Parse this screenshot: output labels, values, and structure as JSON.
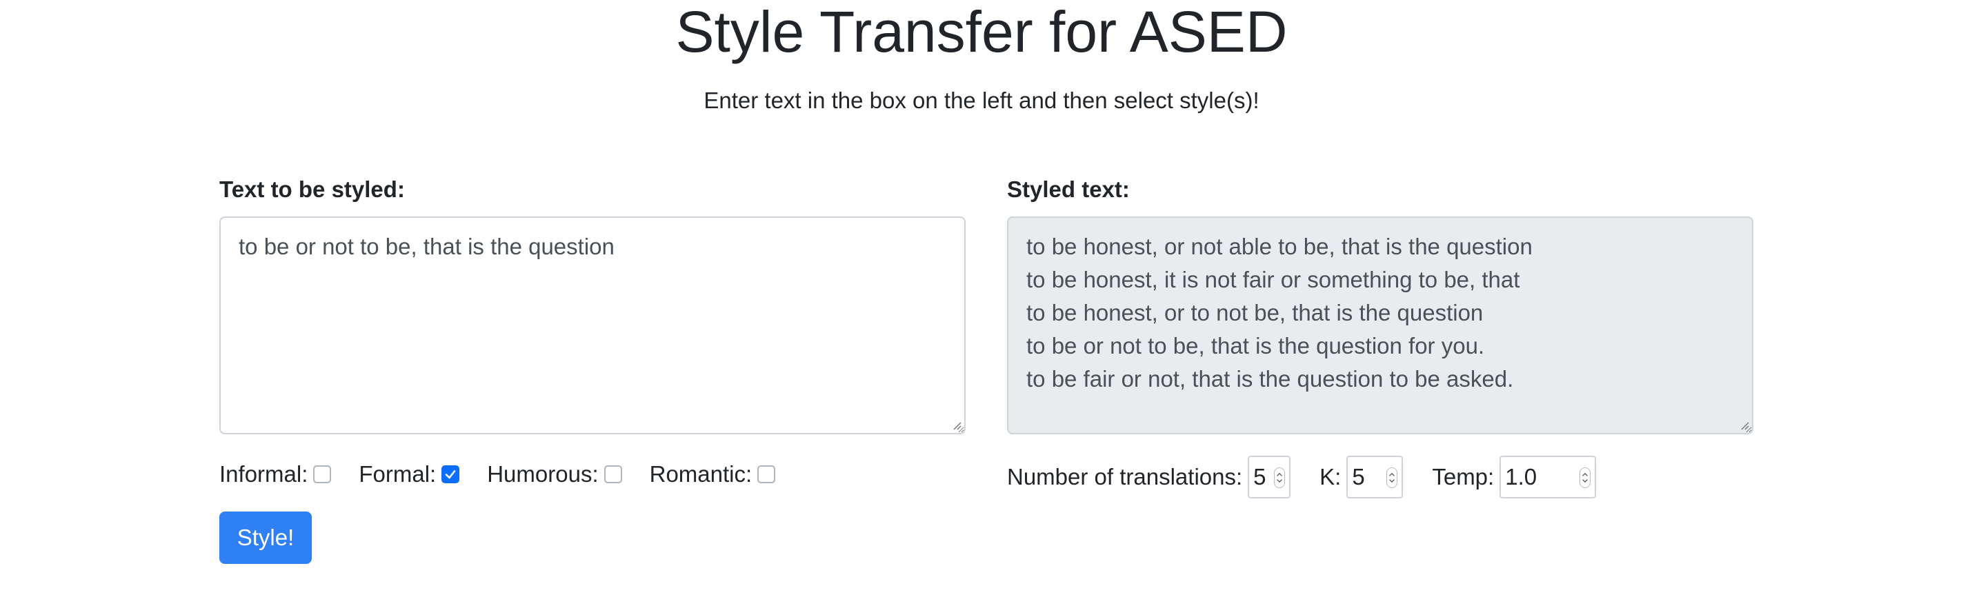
{
  "header": {
    "title": "Style Transfer for ASED",
    "subtitle": "Enter text in the box on the left and then select style(s)!"
  },
  "input_panel": {
    "label": "Text to be styled:",
    "value": "to be or not to be, that is the question"
  },
  "output_panel": {
    "label": "Styled text:",
    "lines": [
      "to be honest, or not able to be, that is the question",
      "to be honest, it is not fair or something to be, that",
      "to be honest, or to not be, that is the question",
      "to be or not to be, that is the question for you.",
      "to be fair or not, that is the question to be asked."
    ]
  },
  "styles": [
    {
      "label": "Informal:",
      "checked": false
    },
    {
      "label": "Formal:",
      "checked": true
    },
    {
      "label": "Humorous:",
      "checked": false
    },
    {
      "label": "Romantic:",
      "checked": false
    }
  ],
  "style_button": {
    "label": "Style!"
  },
  "params": {
    "num_translations": {
      "label": "Number of translations:",
      "value": "5"
    },
    "k": {
      "label": "K:",
      "value": "5"
    },
    "temp": {
      "label": "Temp:",
      "value": "1.0"
    }
  },
  "colors": {
    "accent": "#2f7ff5",
    "checkbox_checked": "#0d6efd",
    "readonly_bg": "#e9ecef",
    "border": "#ced4da"
  }
}
